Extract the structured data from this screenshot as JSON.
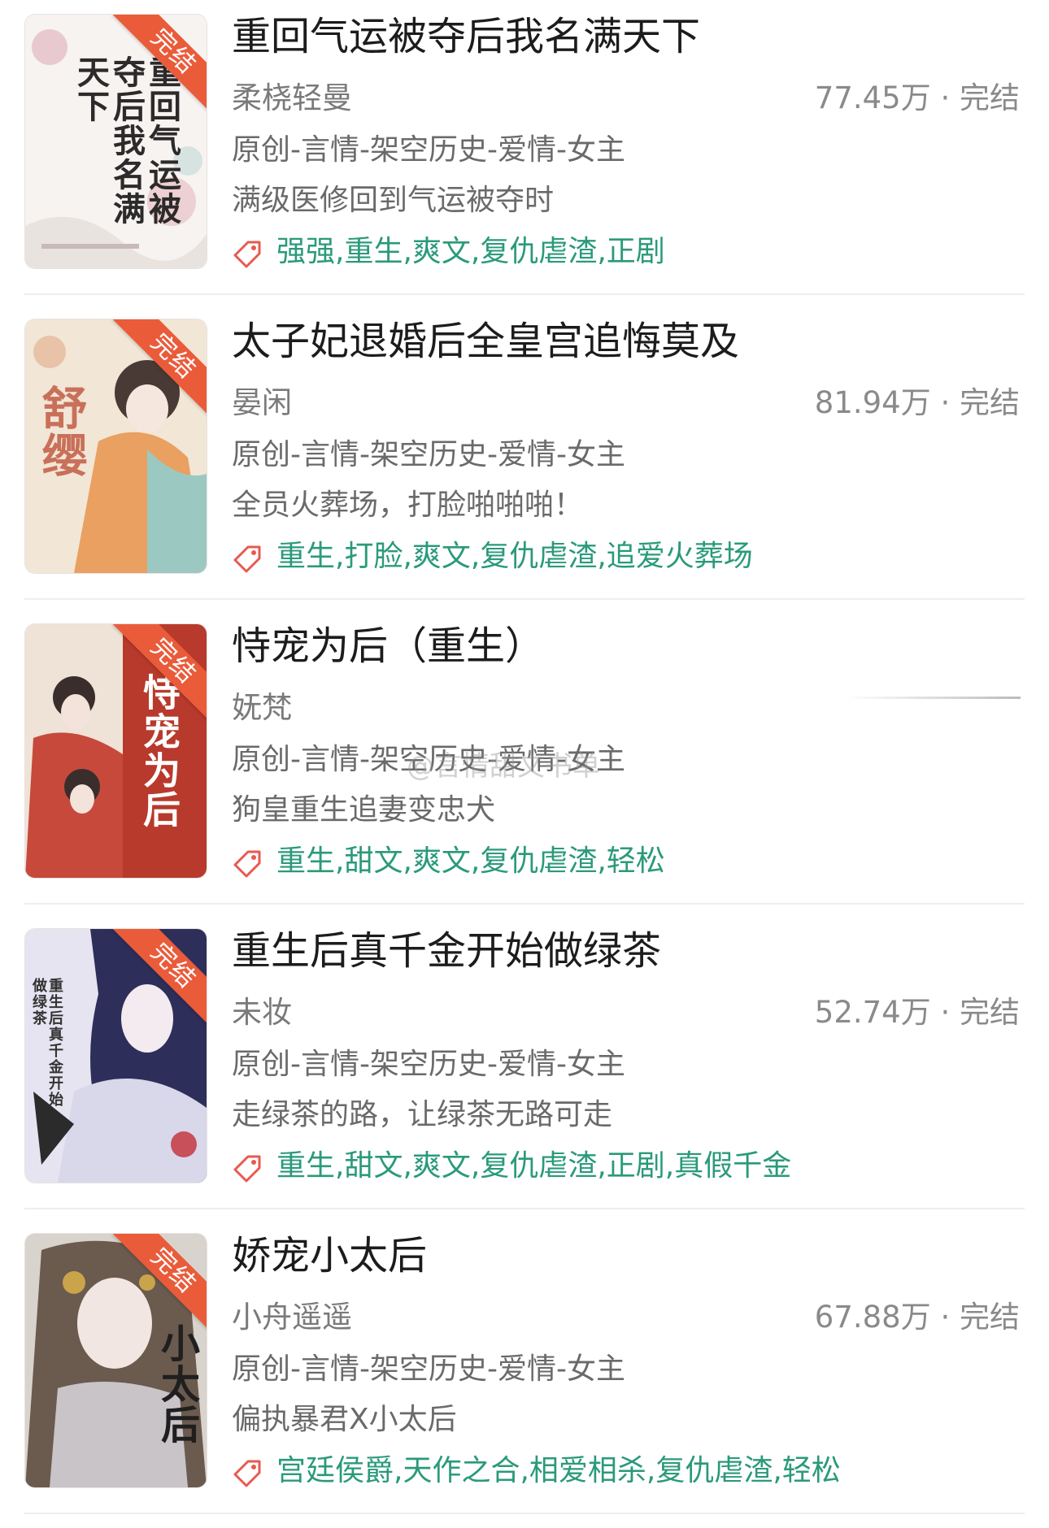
{
  "books": [
    {
      "title": "重回气运被夺后我名满天下",
      "author": "柔桡轻曼",
      "meta": "77.45万 · 完结",
      "category": "原创-言情-架空历史-爱情-女主",
      "intro": "满级医修回到气运被夺时",
      "tags": "强强,重生,爽文,复仇虐渣,正剧",
      "badge": "完结",
      "cover_text": "重回气运被夺后我名满天下"
    },
    {
      "title": "太子妃退婚后全皇宫追悔莫及",
      "author": "晏闲",
      "meta": "81.94万 · 完结",
      "category": "原创-言情-架空历史-爱情-女主",
      "intro": "全员火葬场，打脸啪啪啪！",
      "tags": "重生,打脸,爽文,复仇虐渣,追爱火葬场",
      "badge": "完结",
      "cover_text": "舒缨"
    },
    {
      "title": "恃宠为后（重生）",
      "author": "妩梵",
      "meta": "",
      "category": "原创-言情-架空历史-爱情-女主",
      "intro": "狗皇重生追妻变忠犬",
      "tags": "重生,甜文,爽文,复仇虐渣,轻松",
      "badge": "完结",
      "cover_text": "恃宠为后"
    },
    {
      "title": "重生后真千金开始做绿茶",
      "author": "未妆",
      "meta": "52.74万 · 完结",
      "category": "原创-言情-架空历史-爱情-女主",
      "intro": "走绿茶的路，让绿茶无路可走",
      "tags": "重生,甜文,爽文,复仇虐渣,正剧,真假千金",
      "badge": "完结",
      "cover_text": "重生后真千金开始做绿茶"
    },
    {
      "title": "娇宠小太后",
      "author": "小舟遥遥",
      "meta": "67.88万 · 完结",
      "category": "原创-言情-架空历史-爱情-女主",
      "intro": "偏执暴君X小太后",
      "tags": "宫廷侯爵,天作之合,相爱相杀,复仇虐渣,轻松",
      "badge": "完结",
      "cover_text": "小太后"
    }
  ],
  "watermark": "@言情甜文书单",
  "colors": {
    "tag_green": "#2a9a7a",
    "badge_orange": "#ea5b3a",
    "tag_icon": "#e9594f"
  }
}
